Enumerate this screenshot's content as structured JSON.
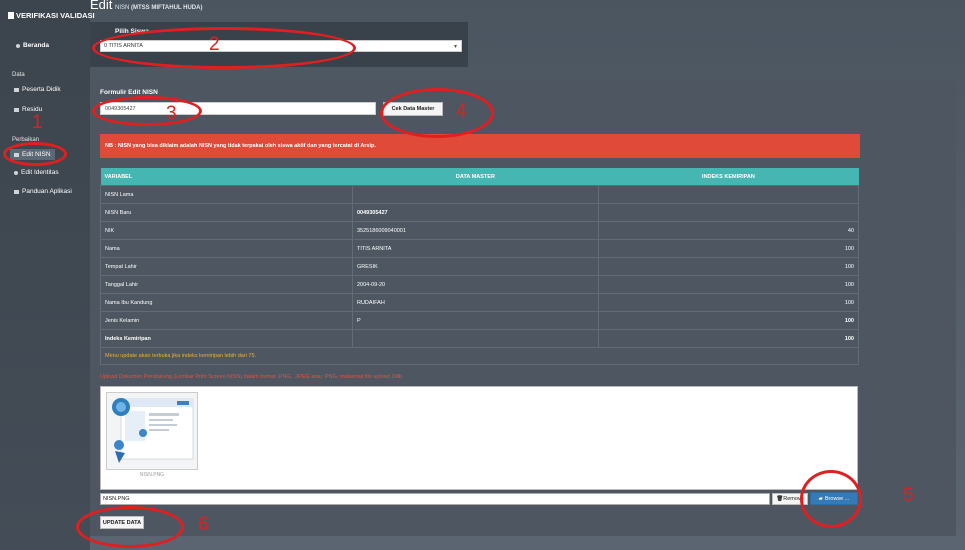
{
  "sidebar": {
    "brand": "VERIFIKASI VALIDASI",
    "home": "Beranda",
    "section_data": "Data",
    "peserta_didik": "Peserta Didik",
    "residu": "Residu",
    "section_perbaikan": "Perbaikan",
    "edit_nisn": "Edit NISN",
    "edit_identitas": "Edit Identitas",
    "panduan": "Panduan Aplikasi"
  },
  "header": {
    "title": "Edit",
    "subtitle_prefix": "NISN",
    "school": "(MTSS MIFTAHUL HUDA)"
  },
  "select_panel": {
    "label": "Pilih Siswa",
    "selected": "0 TITIS ARNITA"
  },
  "form": {
    "label": "Formulir Edit NISN",
    "nisn_value": "0049305427",
    "check_button": "Cek Data Master"
  },
  "alert": "NB : NISN yang bisa diklaim adalah NISN yang tidak terpakai oleh siswa aktif dan yang tercatat di Arsip.",
  "table": {
    "headers": [
      "VARIABEL",
      "DATA MASTER",
      "INDEKS KEMIRIPAN"
    ],
    "rows": [
      [
        "NISN Lama",
        "",
        ""
      ],
      [
        "NISN Baru",
        "0049305427",
        ""
      ],
      [
        "NIK",
        "3525186009040001",
        "40"
      ],
      [
        "Nama",
        "TITIS ARNITA",
        "100"
      ],
      [
        "Tempat Lahir",
        "GRESIK",
        "100"
      ],
      [
        "Tanggal Lahir",
        "2004-09-20",
        "100"
      ],
      [
        "Nama Ibu Kandung",
        "RUDAIFAH",
        "100"
      ],
      [
        "Jenis Kelamin",
        "P",
        "100"
      ],
      [
        "Indeks Kemiripan",
        "",
        "100"
      ]
    ],
    "note": "Menu update akan terbuka jika indeks kemiripan lebih dari 75."
  },
  "upload": {
    "note": "Upload Dokumen Pendukung (Lembar Print Screen NISN) dalam format .PNG, .JPEG atau .PNG, maksimal file upload 1Mb",
    "thumb_caption": "NISN.PNG",
    "file_name": "NISN.PNG",
    "remove_label": "Remove",
    "browse_label": "Browse ..."
  },
  "update_button": "UPDATE DATA",
  "annotations": [
    "1",
    "2",
    "3",
    "4",
    "5",
    "6"
  ]
}
